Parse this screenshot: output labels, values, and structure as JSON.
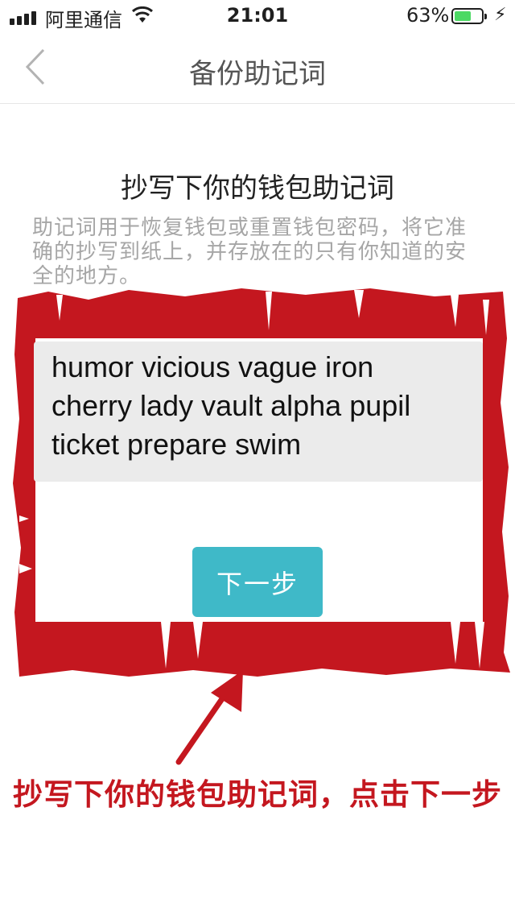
{
  "status_bar": {
    "carrier": "阿里通信",
    "time": "21:01",
    "battery_percent": "63%",
    "battery_level": 0.63,
    "battery_color": "#4cd964"
  },
  "nav": {
    "title": "备份助记词",
    "back_icon": "chevron-left-icon"
  },
  "content": {
    "heading": "抄写下你的钱包助记词",
    "description": "助记词用于恢复钱包或重置钱包密码，将它准确的抄写到纸上，并存放在的只有你知道的安全的地方。",
    "mnemonic_lines": [
      "humor vicious vague iron",
      "cherry lady vault alpha pupil",
      "ticket prepare swim"
    ],
    "next_button_label": "下一步",
    "accent_color": "#3fb9c8"
  },
  "annotation": {
    "caption": "抄写下你的钱包助记词，点击下一步",
    "color": "#c4171f"
  }
}
